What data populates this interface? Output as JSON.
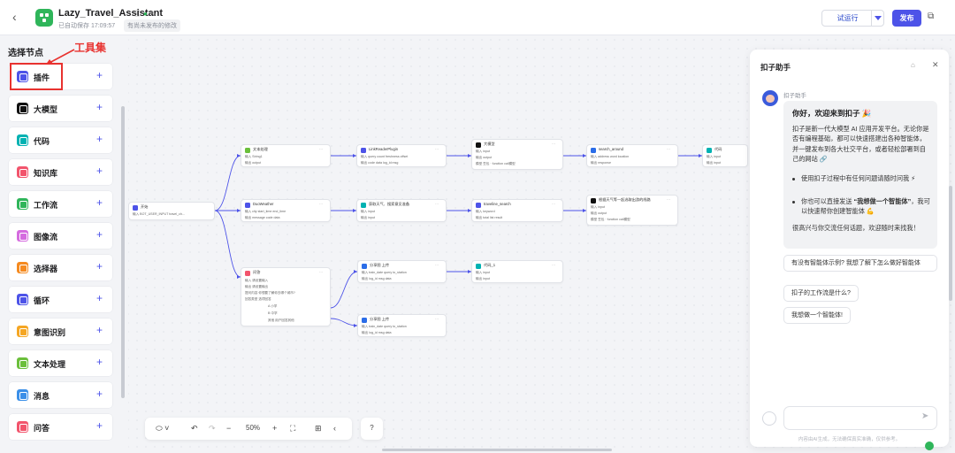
{
  "topbar": {
    "title": "Lazy_Travel_Assistant",
    "autosave": "已自动保存 17:09:57",
    "unpublished": "有尚未发布的修改",
    "test_run": "试运行",
    "publish": "发布"
  },
  "panel": {
    "title": "选择节点",
    "annotation": "工具集",
    "items": [
      {
        "label": "插件",
        "color": "#4d53e8"
      },
      {
        "label": "大模型",
        "color": "#111111"
      },
      {
        "label": "代码",
        "color": "#00b2b2"
      },
      {
        "label": "知识库",
        "color": "#f2546c"
      },
      {
        "label": "工作流",
        "color": "#2fb55a"
      },
      {
        "label": "图像流",
        "color": "#d56bdf"
      },
      {
        "label": "选择器",
        "color": "#f58a1f"
      },
      {
        "label": "循环",
        "color": "#4d53e8"
      },
      {
        "label": "意图识别",
        "color": "#f5a623"
      },
      {
        "label": "文本处理",
        "color": "#6bbf3b"
      },
      {
        "label": "消息",
        "color": "#3b8fe8"
      },
      {
        "label": "问答",
        "color": "#f2546c"
      }
    ]
  },
  "nodes": [
    {
      "title": "开始",
      "color": "#4d53e8",
      "rows": [
        "输入  BOT_USER_INPUT  travel_ch..."
      ]
    },
    {
      "title": "文本处理",
      "color": "#6bbf3b",
      "rows": [
        "输入  String1",
        "输出  output"
      ]
    },
    {
      "title": "LinkReaderPlugin",
      "color": "#4d53e8",
      "rows": [
        "输入  query  count  freshness  offset",
        "输出  code  data  log_id  msg"
      ]
    },
    {
      "title": "大模型",
      "color": "#111111",
      "rows": [
        "输入  input",
        "输出  output",
        "模型  豆包 · function call模型"
      ]
    },
    {
      "title": "search_around",
      "color": "#2b6de8",
      "rows": [
        "输入  address  word  location",
        "输出  response"
      ]
    },
    {
      "title": "代码",
      "color": "#00b2b2",
      "rows": [
        "输入  input",
        "输出  input"
      ]
    },
    {
      "title": "DuoWeather",
      "color": "#4d53e8",
      "rows": [
        "输入  city  start_time  end_time",
        "输出  message  code  data"
      ]
    },
    {
      "title": "获取天气、搜索意见准备",
      "color": "#00b2b2",
      "rows": [
        "输入  input",
        "输出  input"
      ]
    },
    {
      "title": "traveline_search",
      "color": "#4d53e8",
      "rows": [
        "输入  keyword",
        "输出  total  list  result"
      ]
    },
    {
      "title": "根据天气等一起选取出游的线路",
      "color": "#111111",
      "rows": [
        "输入  input",
        "输出  output",
        "模型  豆包 · function call模型"
      ]
    },
    {
      "title": "问答",
      "color": "#f2546c",
      "rows": [
        "输入  请设置输入",
        "输出  请设置输出",
        "提问内容  你想要了解你去哪个城市?",
        "回答类型  选项回答",
        "A  小学",
        "B  中学",
        "其他  用户回答其他"
      ]
    },
    {
      "title": "分享图 上传",
      "color": "#2b6de8",
      "rows": [
        "输入  train_date  query  to_station",
        "输出  log_id  msg  data"
      ]
    },
    {
      "title": "代码_1",
      "color": "#00b2b2",
      "rows": [
        "输入  input",
        "输出  input"
      ]
    },
    {
      "title": "分享图 上传",
      "color": "#2b6de8",
      "rows": [
        "输入  train_date  query  to_station",
        "输出  log_id  msg  data"
      ]
    }
  ],
  "toolbar": {
    "zoom": "50%"
  },
  "assistant": {
    "title": "扣子助手",
    "sender": "扣子助手",
    "greeting": "你好，欢迎来到扣子 🎉",
    "intro": "扣子是新一代大模型 AI 应用开发平台。无论你是否有编程基础，都可以快速搭建出各种智能体，并一键发布到各大社交平台，或者轻松部署到自己的网站 🔗",
    "bullet1": "使用扣子过程中有任何问题请随时问我 ⚡",
    "bullet2_pre": "你也可以直接发送 ",
    "bullet2_bold": "“我想做一个智能体”",
    "bullet2_post": "，我可以快速帮你创建智能体 💪",
    "closing": "很高兴与你交流任何话题，欢迎随时来找我！",
    "suggestions": [
      "有没有智能体示例? 我想了解下怎么做好智能体",
      "扣子的工作流是什么?",
      "我想做一个智能体!"
    ],
    "disclaimer": "内容由AI生成，无法确保真实准确，仅供参考。"
  }
}
